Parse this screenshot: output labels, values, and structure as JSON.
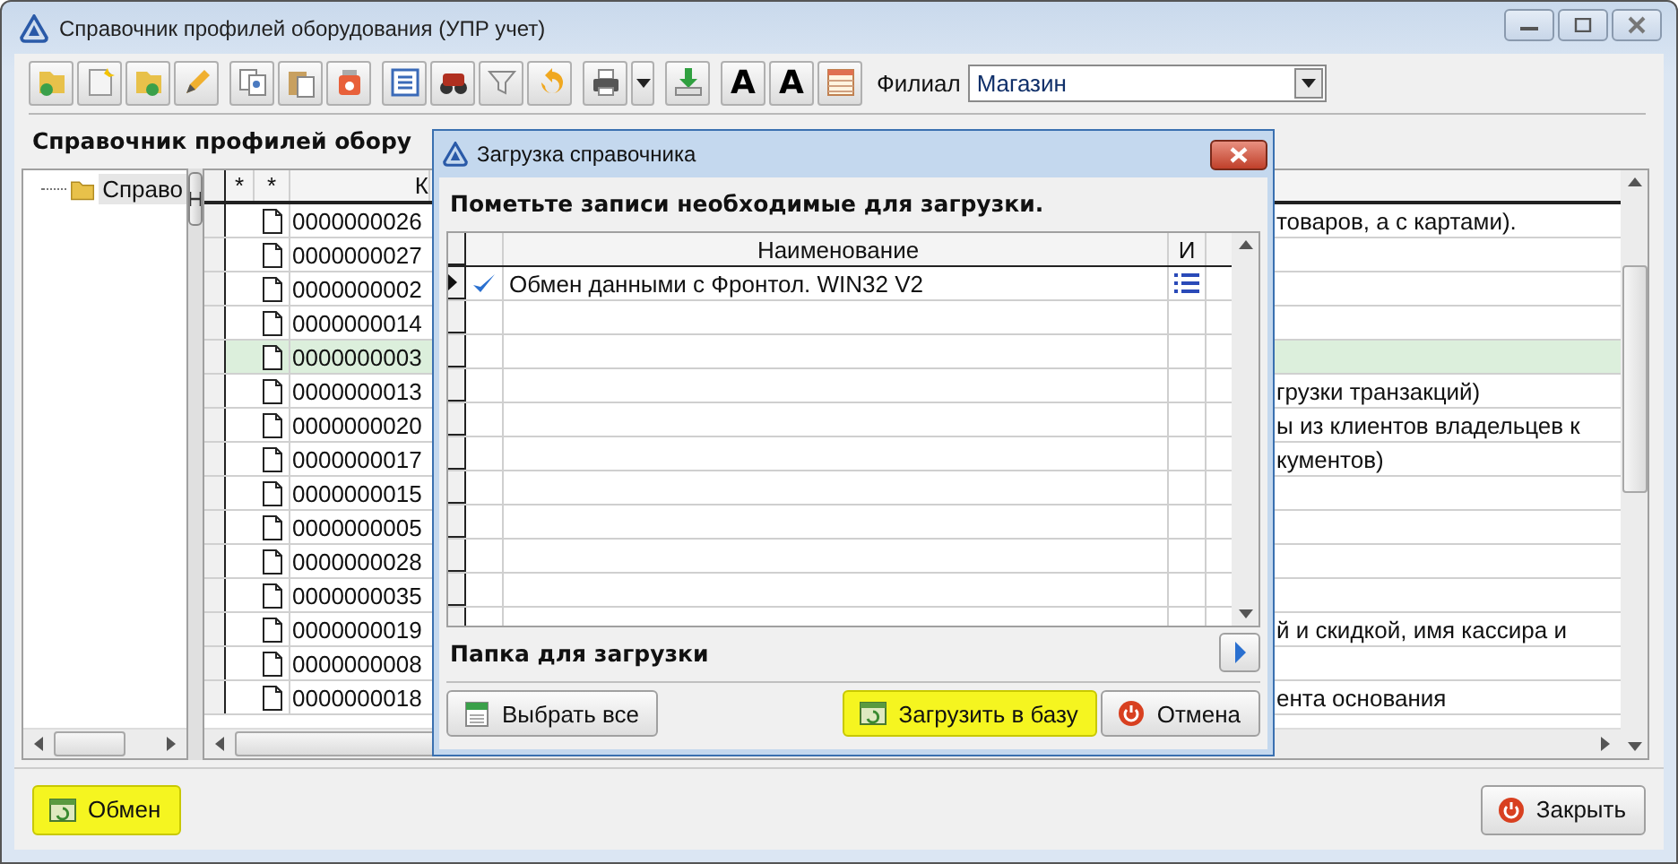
{
  "window": {
    "title": "Справочник профилей оборудования (УПР учет)"
  },
  "toolbar": {
    "font_buttons": [
      {
        "glyph": "A"
      },
      {
        "glyph": "A"
      }
    ],
    "branch_label": "Филиал",
    "branch_value": "Магазин"
  },
  "heading": "Справочник профилей обору",
  "tree": {
    "items": [
      {
        "label": "Справо",
        "selected": true
      }
    ]
  },
  "table": {
    "columns": [
      {
        "label": "*"
      },
      {
        "label": "*"
      },
      {
        "label": "К"
      }
    ],
    "rows": [
      {
        "code": "0000000026",
        "column_3": "товаров, а с картами).",
        "selected": false
      },
      {
        "code": "0000000027",
        "column_3": "",
        "selected": false
      },
      {
        "code": "0000000002",
        "column_3": "",
        "selected": false
      },
      {
        "code": "0000000014",
        "column_3": "",
        "selected": false
      },
      {
        "code": "0000000003",
        "column_3": "",
        "selected": true
      },
      {
        "code": "0000000013",
        "column_3": "грузки транзакций)",
        "selected": false
      },
      {
        "code": "0000000020",
        "column_3": "ы из клиентов владельцев к",
        "selected": false
      },
      {
        "code": "0000000017",
        "column_3": "кументов)",
        "selected": false
      },
      {
        "code": "0000000015",
        "column_3": "",
        "selected": false
      },
      {
        "code": "0000000005",
        "column_3": "",
        "selected": false
      },
      {
        "code": "0000000028",
        "column_3": "",
        "selected": false
      },
      {
        "code": "0000000035",
        "column_3": "",
        "selected": false
      },
      {
        "code": "0000000019",
        "column_3": "й и скидкой, имя кассира и",
        "selected": false
      },
      {
        "code": "0000000008",
        "column_3": "",
        "selected": false
      },
      {
        "code": "0000000018",
        "column_3": "ента основания",
        "selected": false
      }
    ]
  },
  "dialog": {
    "title": "Загрузка справочника",
    "instruction": "Пометьте записи необходимые для загрузки.",
    "columns": [
      "Наименование",
      "И"
    ],
    "rows": [
      {
        "checked": true,
        "current": true,
        "name": "Обмен данными с Фронтол. WIN32 V2"
      }
    ],
    "folder_label": "Папка для загрузки",
    "buttons": [
      {
        "label": "Выбрать все",
        "kind": "select_all",
        "highlighted": false
      },
      {
        "label": "Загрузить в базу",
        "kind": "load",
        "highlighted": true
      },
      {
        "label": "Отмена",
        "kind": "cancel",
        "highlighted": false
      }
    ]
  },
  "footer": {
    "buttons": [
      {
        "label": "Обмен",
        "kind": "exchange",
        "highlighted": true
      },
      {
        "label": "Закрыть",
        "kind": "close",
        "highlighted": false
      }
    ]
  }
}
